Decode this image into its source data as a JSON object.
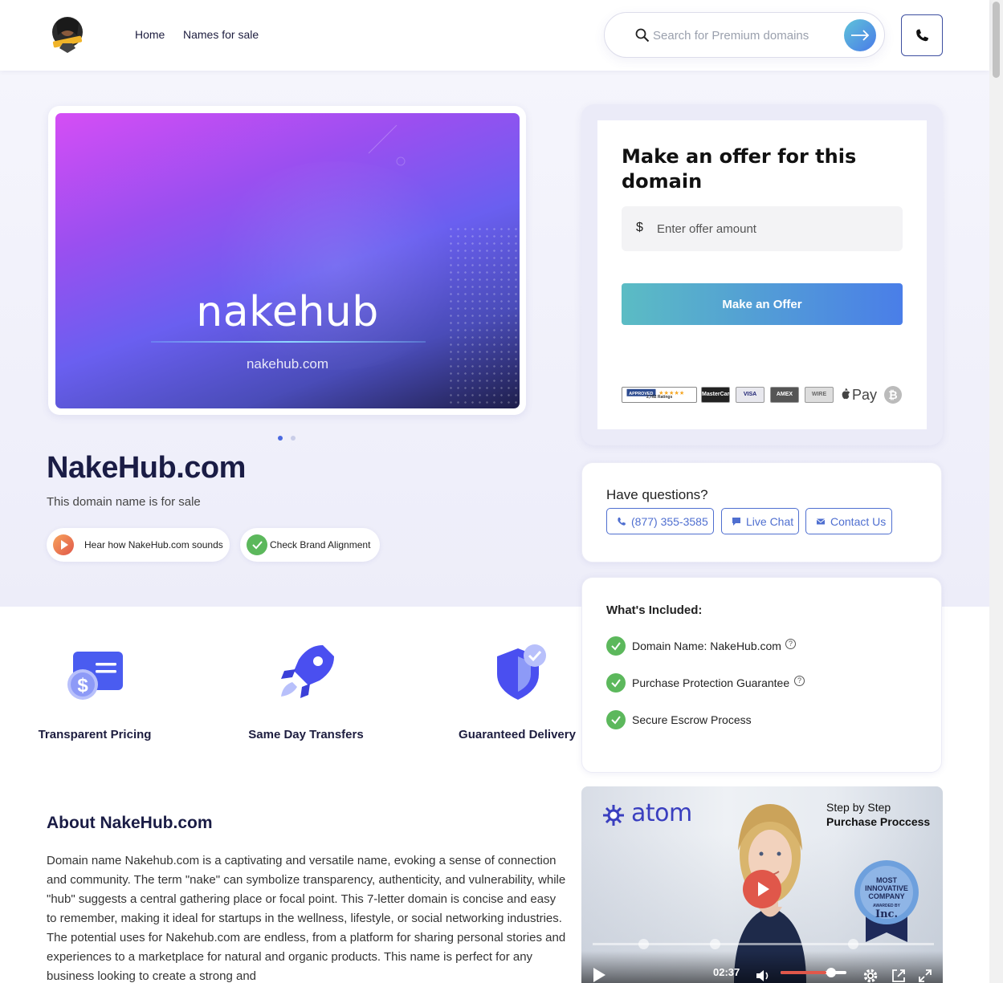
{
  "header": {
    "nav": [
      "Home",
      "Names for sale"
    ],
    "search_placeholder": "Search for Premium domains"
  },
  "hero": {
    "banner_word": "nakehub",
    "banner_domain": "nakehub.com",
    "domain_title": "NakeHub.com",
    "domain_subtitle": "This domain name is for sale",
    "pill_listen": "Hear how NakeHub.com sounds",
    "pill_brand": "Check Brand Alignment",
    "slides": 2,
    "active_slide": 1
  },
  "offer": {
    "title": "Make an offer for this domain",
    "currency_symbol": "$",
    "amount_placeholder": "Enter offer amount",
    "button_label": "Make an Offer",
    "payment_methods": [
      "Approved 2,782 Ratings",
      "MasterCard",
      "VISA",
      "American Express",
      "Wire Transfer",
      "Apple Pay",
      "Bitcoin"
    ],
    "rating_text": "2,782 Ratings",
    "apple_pay_label": "Pay"
  },
  "questions": {
    "title": "Have questions?",
    "phone": "(877) 355-3585",
    "live_chat": "Live Chat",
    "contact": "Contact Us"
  },
  "included": {
    "title": "What's Included:",
    "items": [
      "Domain Name: NakeHub.com",
      "Purchase Protection Guarantee",
      "Secure Escrow Process"
    ]
  },
  "features": [
    {
      "label": "Transparent Pricing",
      "icon": "pricing-icon"
    },
    {
      "label": "Same Day Transfers",
      "icon": "rocket-icon"
    },
    {
      "label": "Guaranteed Delivery",
      "icon": "shield-icon"
    }
  ],
  "about": {
    "heading": "About NakeHub.com",
    "text": "Domain name Nakehub.com is a captivating and versatile name, evoking a sense of connection and community. The term \"nake\" can symbolize transparency, authenticity, and vulnerability, while \"hub\" suggests a central gathering place or focal point. This 7-letter domain is concise and easy to remember, making it ideal for startups in the wellness, lifestyle, or social networking industries. The potential uses for Nakehub.com are endless, from a platform for sharing personal stories and experiences to a marketplace for natural and organic products. This name is perfect for any business looking to create a strong and"
  },
  "video": {
    "brand": "atom",
    "step_line1": "Step by Step",
    "step_line2": "Purchase Proccess",
    "badge_line1": "MOST",
    "badge_line2": "INNOVATIVE",
    "badge_line3": "COMPANY",
    "badge_line4": "AWARDED BY",
    "badge_brand": "Inc.",
    "time": "02:37",
    "volume": 0.7
  },
  "colors": {
    "accent": "#4a7be8",
    "navy": "#1a1c45",
    "check_green": "#5cb85c",
    "play_red": "#e0574a"
  }
}
